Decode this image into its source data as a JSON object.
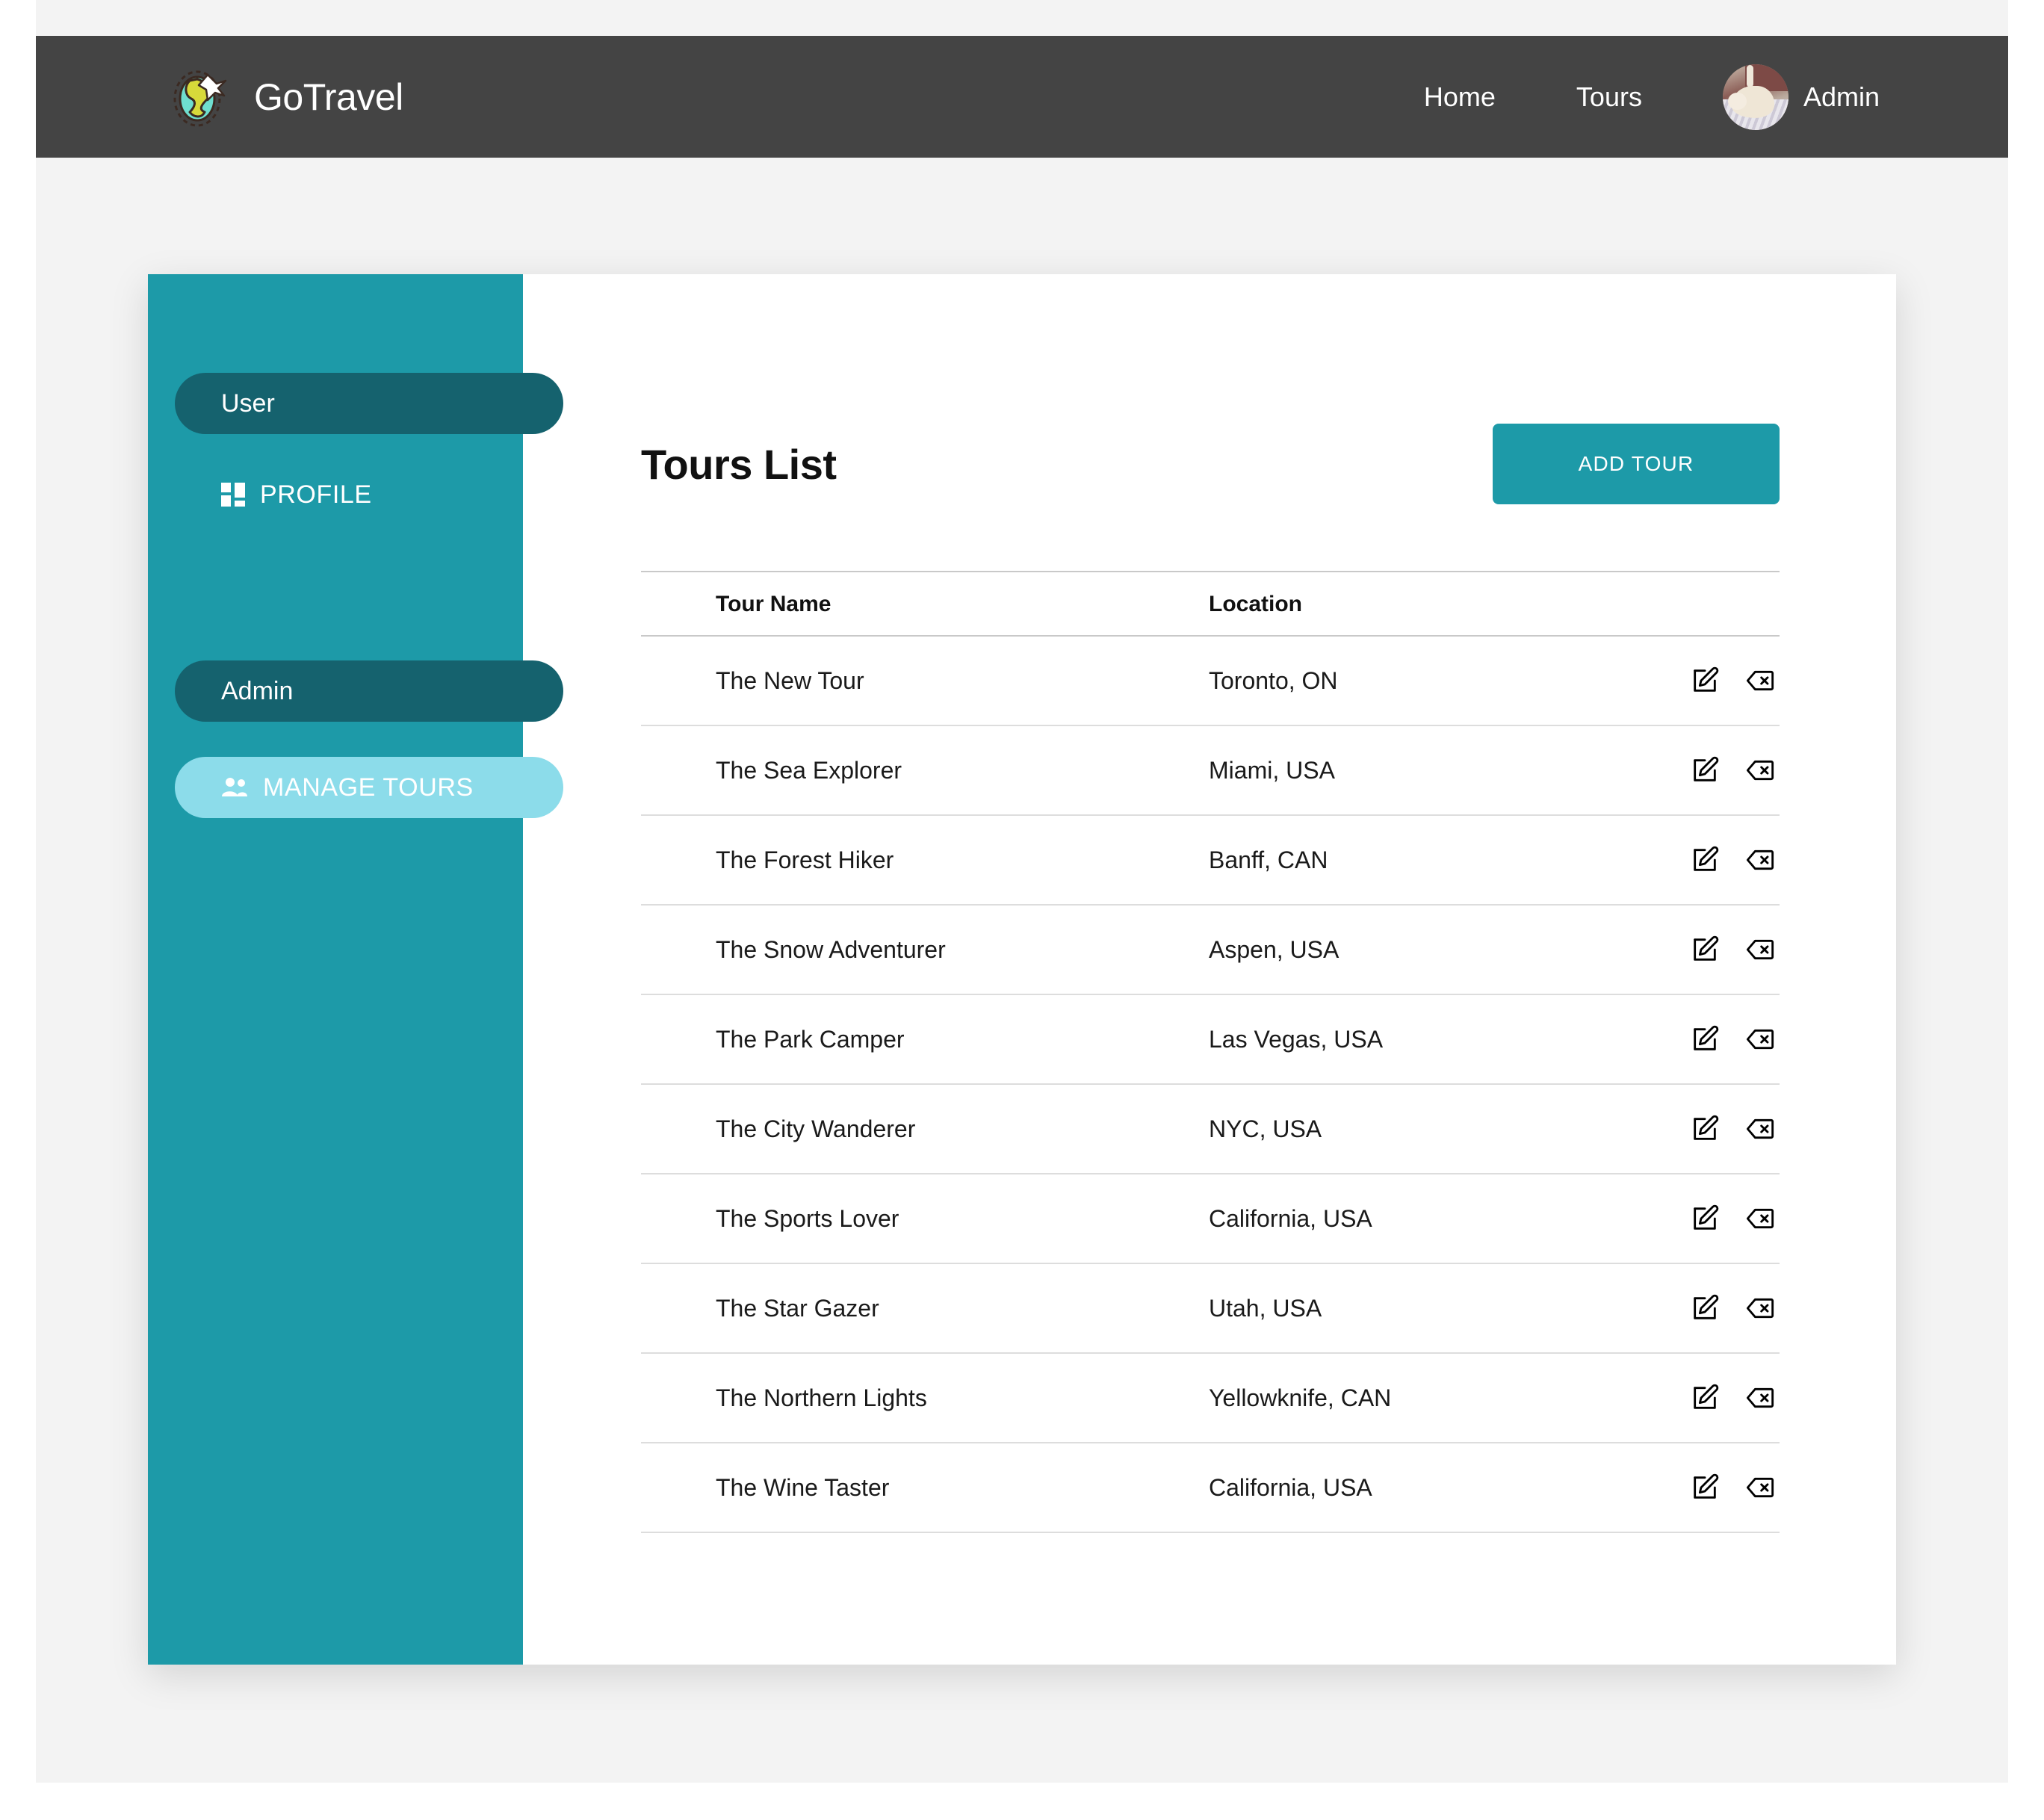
{
  "header": {
    "brand_name": "GoTravel",
    "logo_icon": "globe-airplane-logo",
    "nav": [
      {
        "label": "Home",
        "icon": ""
      },
      {
        "label": "Tours",
        "icon": ""
      }
    ],
    "user": {
      "name": "Admin",
      "avatar_icon": "user-avatar-photo"
    }
  },
  "sidebar": {
    "background_color": "#1d9aa8",
    "section_color": "#15626e",
    "active_color": "#8cdcea",
    "groups": [
      {
        "label": "User",
        "items": [
          {
            "label": "PROFILE",
            "icon": "dashboard-grid-icon",
            "active": false
          }
        ]
      },
      {
        "label": "Admin",
        "items": [
          {
            "label": "MANAGE TOURS",
            "icon": "people-icon",
            "active": true
          }
        ]
      }
    ]
  },
  "main": {
    "title": "Tours List",
    "add_button_label": "ADD TOUR",
    "accent_color": "#1d9aa8",
    "table": {
      "columns": [
        "Tour Name",
        "Location"
      ],
      "rows": [
        {
          "name": "The New Tour",
          "location": "Toronto, ON",
          "thumb": "sc-lake",
          "edit_icon": "edit-icon",
          "delete_icon": "delete-icon"
        },
        {
          "name": "The Sea Explorer",
          "location": "Miami, USA",
          "thumb": "sc-sea",
          "edit_icon": "edit-icon",
          "delete_icon": "delete-icon"
        },
        {
          "name": "The Forest Hiker",
          "location": "Banff, CAN",
          "thumb": "sc-forest",
          "edit_icon": "edit-icon",
          "delete_icon": "delete-icon"
        },
        {
          "name": "The Snow Adventurer",
          "location": "Aspen, USA",
          "thumb": "sc-snow",
          "edit_icon": "edit-icon",
          "delete_icon": "delete-icon"
        },
        {
          "name": "The Park Camper",
          "location": "Las Vegas, USA",
          "thumb": "sc-canyon",
          "edit_icon": "edit-icon",
          "delete_icon": "delete-icon"
        },
        {
          "name": "The City Wanderer",
          "location": "NYC, USA",
          "thumb": "sc-city",
          "edit_icon": "edit-icon",
          "delete_icon": "delete-icon"
        },
        {
          "name": "The Sports Lover",
          "location": "California, USA",
          "thumb": "sc-surf",
          "edit_icon": "edit-icon",
          "delete_icon": "delete-icon"
        },
        {
          "name": "The Star Gazer",
          "location": "Utah, USA",
          "thumb": "sc-star",
          "edit_icon": "edit-icon",
          "delete_icon": "delete-icon"
        },
        {
          "name": "The Northern Lights",
          "location": "Yellowknife, CAN",
          "thumb": "sc-north",
          "edit_icon": "edit-icon",
          "delete_icon": "delete-icon"
        },
        {
          "name": "The Wine Taster",
          "location": "California, USA",
          "thumb": "sc-wine",
          "edit_icon": "edit-icon",
          "delete_icon": "delete-icon"
        }
      ]
    }
  }
}
